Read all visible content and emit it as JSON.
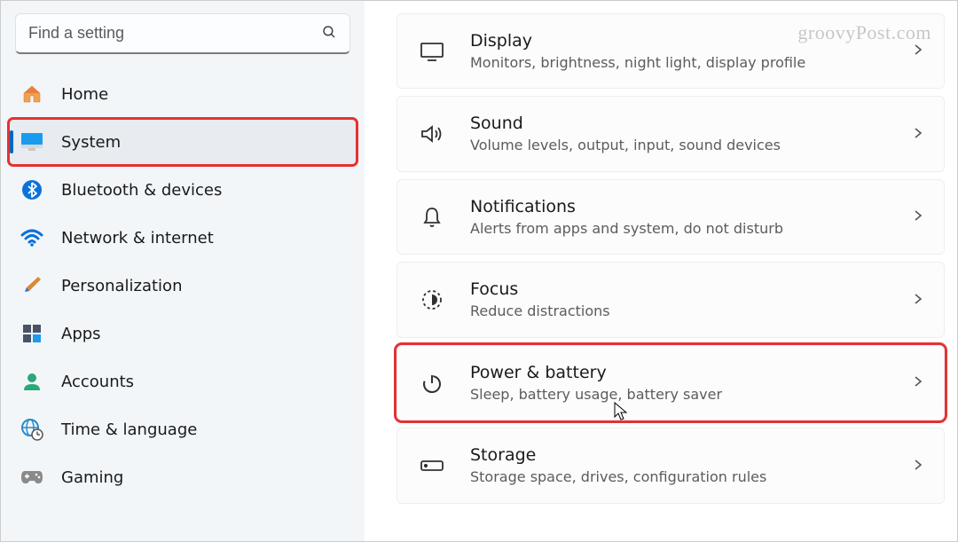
{
  "search": {
    "placeholder": "Find a setting"
  },
  "sidebar": {
    "items": [
      {
        "label": "Home"
      },
      {
        "label": "System"
      },
      {
        "label": "Bluetooth & devices"
      },
      {
        "label": "Network & internet"
      },
      {
        "label": "Personalization"
      },
      {
        "label": "Apps"
      },
      {
        "label": "Accounts"
      },
      {
        "label": "Time & language"
      },
      {
        "label": "Gaming"
      }
    ]
  },
  "main": {
    "cards": [
      {
        "title": "Display",
        "sub": "Monitors, brightness, night light, display profile"
      },
      {
        "title": "Sound",
        "sub": "Volume levels, output, input, sound devices"
      },
      {
        "title": "Notifications",
        "sub": "Alerts from apps and system, do not disturb"
      },
      {
        "title": "Focus",
        "sub": "Reduce distractions"
      },
      {
        "title": "Power & battery",
        "sub": "Sleep, battery usage, battery saver"
      },
      {
        "title": "Storage",
        "sub": "Storage space, drives, configuration rules"
      }
    ]
  },
  "watermark": "groovyPost.com"
}
